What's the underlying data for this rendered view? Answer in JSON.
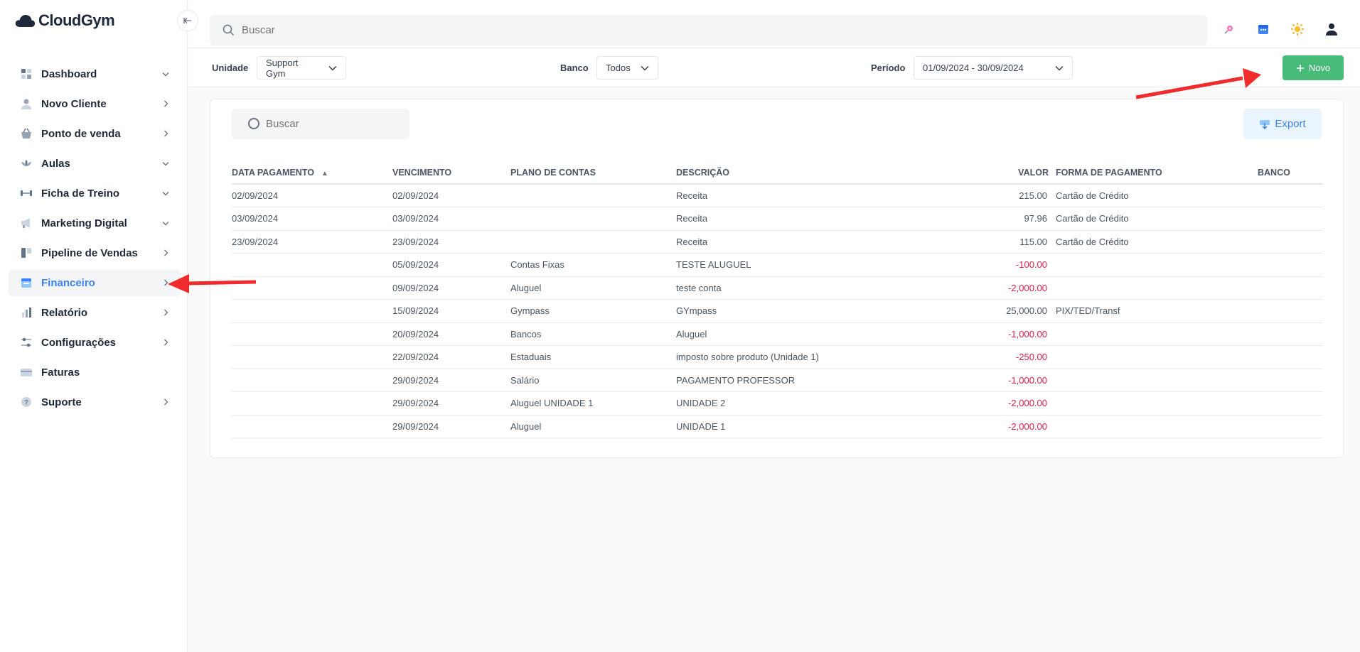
{
  "app": {
    "brand": "CloudGym"
  },
  "sidebar": {
    "items": [
      {
        "label": "Dashboard",
        "icon": "dashboard-icon",
        "chevron": "down",
        "active": false
      },
      {
        "label": "Novo Cliente",
        "icon": "user-icon",
        "chevron": "right",
        "active": false
      },
      {
        "label": "Ponto de venda",
        "icon": "basket-icon",
        "chevron": "right",
        "active": false
      },
      {
        "label": "Aulas",
        "icon": "lotus-icon",
        "chevron": "down",
        "active": false
      },
      {
        "label": "Ficha de Treino",
        "icon": "dumbbell-icon",
        "chevron": "down",
        "active": false
      },
      {
        "label": "Marketing Digital",
        "icon": "megaphone-icon",
        "chevron": "down",
        "active": false
      },
      {
        "label": "Pipeline de Vendas",
        "icon": "pipeline-icon",
        "chevron": "right",
        "active": false
      },
      {
        "label": "Financeiro",
        "icon": "calendar-icon",
        "chevron": "right",
        "active": true
      },
      {
        "label": "Relatório",
        "icon": "bar-chart-icon",
        "chevron": "right",
        "active": false
      },
      {
        "label": "Configurações",
        "icon": "sliders-icon",
        "chevron": "right",
        "active": false
      },
      {
        "label": "Faturas",
        "icon": "credit-card-icon",
        "chevron": "none",
        "active": false
      },
      {
        "label": "Suporte",
        "icon": "help-icon",
        "chevron": "right",
        "active": false
      }
    ]
  },
  "topbar": {
    "search_placeholder": "Buscar",
    "icons": [
      "rocket-icon",
      "calendar-icon",
      "sun-icon",
      "user-icon"
    ]
  },
  "filters": {
    "unidade_label": "Unidade",
    "unidade_value": "Support Gym",
    "banco_label": "Banco",
    "banco_value": "Todos",
    "periodo_label": "Período",
    "periodo_value": "01/09/2024 - 30/09/2024",
    "novo_label": "Novo"
  },
  "card": {
    "search_placeholder": "Buscar",
    "export_label": "Export"
  },
  "table": {
    "columns": [
      "DATA PAGAMENTO",
      "VENCIMENTO",
      "PLANO DE CONTAS",
      "DESCRIÇÃO",
      "VALOR",
      "FORMA DE PAGAMENTO",
      "BANCO"
    ],
    "rows": [
      [
        "02/09/2024",
        "02/09/2024",
        "",
        "Receita",
        "215.00",
        "Cartão de Crédito",
        ""
      ],
      [
        "03/09/2024",
        "03/09/2024",
        "",
        "Receita",
        "97.96",
        "Cartão de Crédito",
        ""
      ],
      [
        "23/09/2024",
        "23/09/2024",
        "",
        "Receita",
        "115.00",
        "Cartão de Crédito",
        ""
      ],
      [
        "",
        "05/09/2024",
        "Contas Fixas",
        "TESTE ALUGUEL",
        "-100.00",
        "",
        ""
      ],
      [
        "",
        "09/09/2024",
        "Aluguel",
        "teste conta",
        "-2,000.00",
        "",
        ""
      ],
      [
        "",
        "15/09/2024",
        "Gympass",
        "GYmpass",
        "25,000.00",
        "PIX/TED/Transf",
        ""
      ],
      [
        "",
        "20/09/2024",
        "Bancos",
        "Aluguel",
        "-1,000.00",
        "",
        ""
      ],
      [
        "",
        "22/09/2024",
        "Estaduais",
        "imposto sobre produto (Unidade 1)",
        "-250.00",
        "",
        ""
      ],
      [
        "",
        "29/09/2024",
        "Salário",
        "PAGAMENTO PROFESSOR",
        "-1,000.00",
        "",
        ""
      ],
      [
        "",
        "29/09/2024",
        "Aluguel UNIDADE 1",
        "UNIDADE 2",
        "-2,000.00",
        "",
        ""
      ],
      [
        "",
        "29/09/2024",
        "Aluguel",
        "UNIDADE 1",
        "-2,000.00",
        "",
        ""
      ]
    ]
  },
  "colors": {
    "accent": "#3b82f6",
    "success": "#48bb78",
    "negative": "#e11d48",
    "annotation": "#ef2b2b"
  }
}
